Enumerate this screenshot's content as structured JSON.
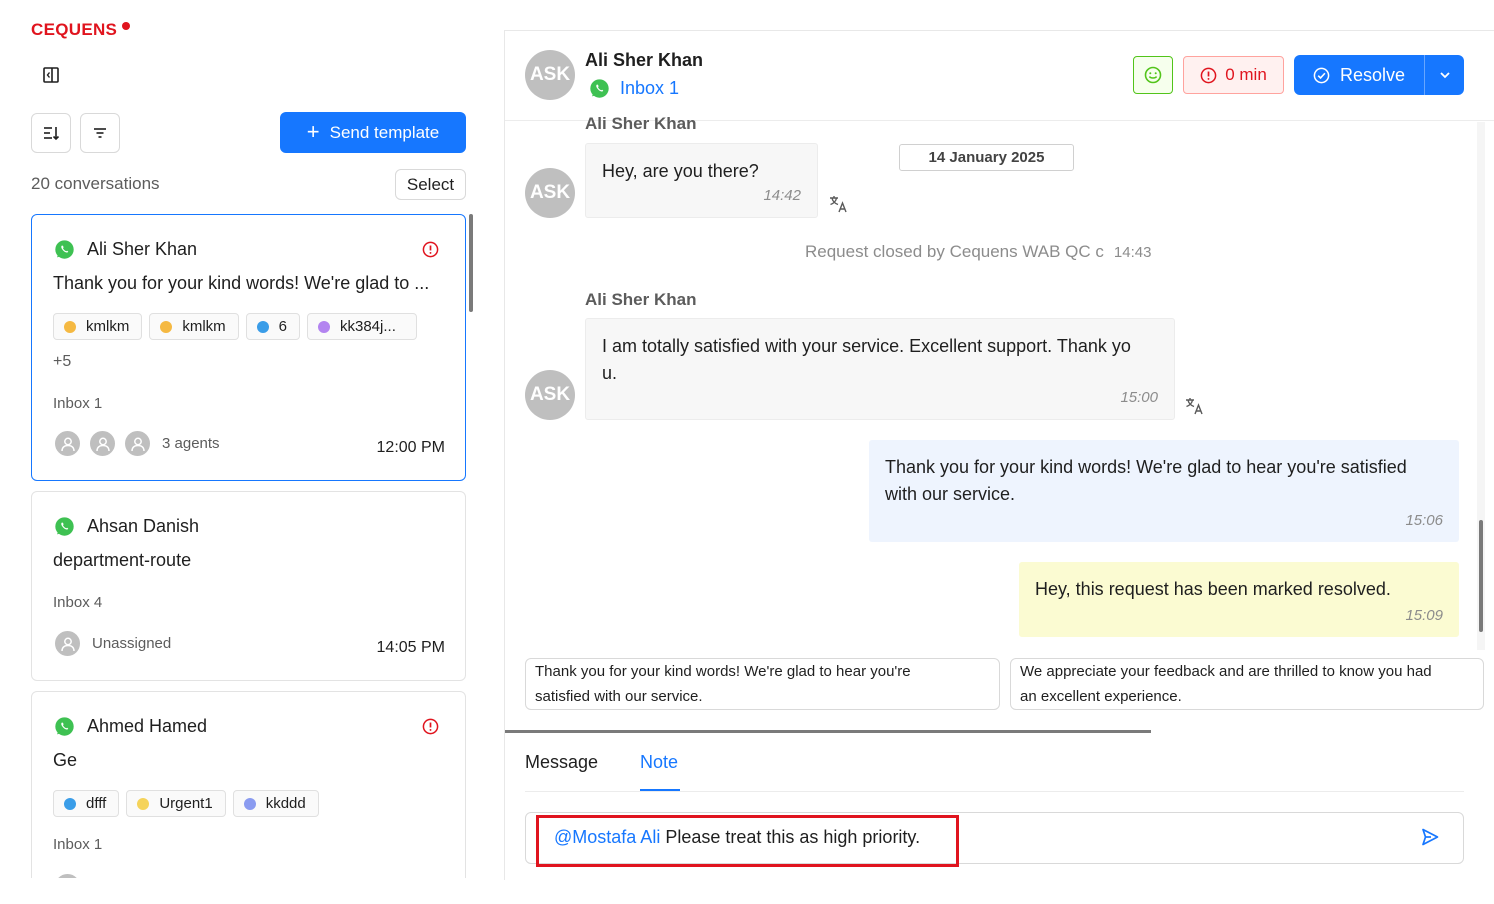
{
  "brand": {
    "name": "CEQUENS",
    "color": "#e0141e"
  },
  "sidebar": {
    "send_template_label": "Send template",
    "conversation_count": "20 conversations",
    "select_label": "Select",
    "conversations": [
      {
        "name": "Ali Sher Khan",
        "preview": "Thank you for your kind words! We're glad to ...",
        "tags": [
          {
            "label": "kmlkm",
            "color": "#f5b942"
          },
          {
            "label": "kmlkm",
            "color": "#f5b942"
          },
          {
            "label": "6",
            "color": "#3a9de8"
          },
          {
            "label": "kk384j...",
            "color": "#b384f0"
          }
        ],
        "more_tags": "+5",
        "inbox": "Inbox 1",
        "agents_label": "3 agents",
        "time": "12:00 PM",
        "alert": true,
        "active": true
      },
      {
        "name": "Ahsan Danish",
        "preview": "department-route",
        "inbox": "Inbox 4",
        "agents_label": "Unassigned",
        "time": "14:05 PM",
        "alert": false
      },
      {
        "name": "Ahmed Hamed",
        "preview": "Ge",
        "tags": [
          {
            "label": "dfff",
            "color": "#3a9de8"
          },
          {
            "label": "Urgent1",
            "color": "#f5d35a"
          },
          {
            "label": "kkddd",
            "color": "#8a9bf0"
          }
        ],
        "inbox": "Inbox 1",
        "alert": true
      }
    ]
  },
  "chat": {
    "contact_initials": "ASK",
    "contact_name": "Ali Sher Khan",
    "inbox": "Inbox 1",
    "sla_label": "0 min",
    "resolve_label": "Resolve",
    "messages": {
      "partial_sender": "Ali Sher Khan",
      "date_badge": "14 January 2025",
      "m1_text": "Hey, are you there?",
      "m1_time": "14:42",
      "system_text": "Request closed by Cequens WAB QC c",
      "system_time": "14:43",
      "m2_sender": "Ali Sher Khan",
      "m2_text_line1": "I am totally satisfied with your service. Excellent support. Thank yo",
      "m2_text_line2": "u.",
      "m2_time": "15:00",
      "m3_text_line1": "Thank you for your kind words! We're glad to hear you're satisfied",
      "m3_text_line2": "with our service.",
      "m3_time": "15:06",
      "m4_text": "Hey, this request has been marked resolved.",
      "m4_time": "15:09"
    },
    "suggestions": [
      {
        "line1": "Thank you for your kind words! We're glad to hear you're",
        "line2": "satisfied with our service."
      },
      {
        "line1": "We appreciate your feedback and are thrilled to know you had",
        "line2": "an excellent experience."
      }
    ],
    "tabs": {
      "message": "Message",
      "note": "Note",
      "active": "Note"
    },
    "composer": {
      "mention": "@Mostafa Ali",
      "text": " Please treat this as high priority."
    }
  }
}
